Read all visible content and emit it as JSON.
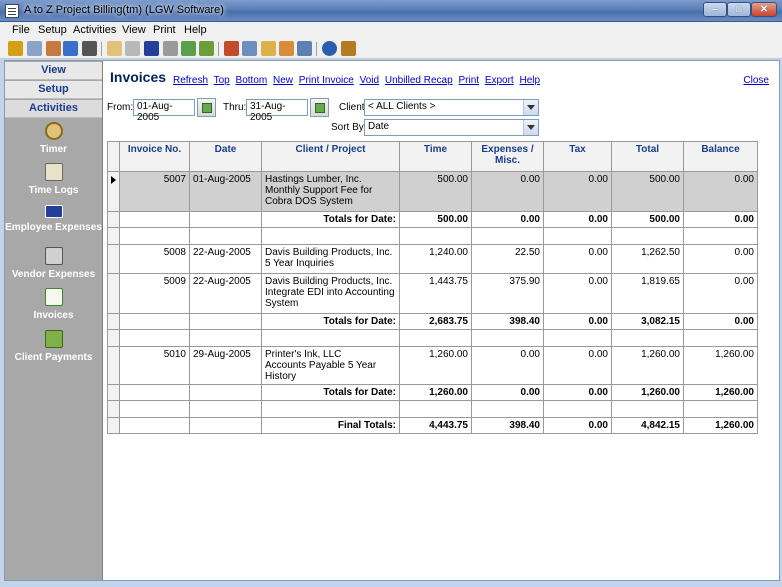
{
  "window": {
    "title": "A to Z Project Billing(tm)  (LGW Software)",
    "min_label": "–",
    "max_label": "□",
    "close_label": "✕"
  },
  "menu": [
    "File",
    "Setup",
    "Activities",
    "View",
    "Print",
    "Help"
  ],
  "toolbar_icons": [
    "users-icon",
    "window-icon",
    "user-icon",
    "people-icon",
    "move-icon",
    "timer-icon",
    "clock-icon",
    "card-icon",
    "calculator-icon",
    "document-icon",
    "ledger-icon",
    "home-icon",
    "grid-icon",
    "report-icon",
    "report2-icon",
    "monitor-icon",
    "help-icon",
    "exit-icon"
  ],
  "sidebar": {
    "view": "View",
    "setup": "Setup",
    "activities": "Activities",
    "nav": [
      "Timer",
      "Time Logs",
      "Employee Expenses",
      "Vendor Expenses",
      "Invoices",
      "Client Payments"
    ]
  },
  "page": {
    "title": "Invoices",
    "links": [
      "Refresh",
      "Top",
      "Bottom",
      "New",
      "Print Invoice",
      "Void",
      "Unbilled Recap",
      "Print",
      "Export",
      "Help"
    ],
    "close": "Close"
  },
  "filters": {
    "from_label": "From:",
    "from_value": "01-Aug-2005",
    "thru_label": "Thru:",
    "thru_value": "31-Aug-2005",
    "client_label": "Client:",
    "client_value": "< ALL Clients >",
    "sort_label": "Sort By:",
    "sort_value": "Date"
  },
  "table": {
    "headers": [
      "Invoice No.",
      "Date",
      "Client / Project",
      "Time",
      "Expenses / Misc.",
      "Tax",
      "Total",
      "Balance"
    ],
    "rows": [
      {
        "invoice": "5007",
        "date": "01-Aug-2005",
        "client": "Hastings Lumber, Inc.",
        "project": "Monthly Support Fee for Cobra DOS System",
        "time": "500.00",
        "expenses": "0.00",
        "tax": "0.00",
        "total": "500.00",
        "balance": "0.00"
      },
      {
        "subtotal_label": "Totals for Date:",
        "time": "500.00",
        "expenses": "0.00",
        "tax": "0.00",
        "total": "500.00",
        "balance": "0.00"
      },
      {
        "invoice": "5008",
        "date": "22-Aug-2005",
        "client": "Davis Building Products, Inc.",
        "project": "5 Year Inquiries",
        "time": "1,240.00",
        "expenses": "22.50",
        "tax": "0.00",
        "total": "1,262.50",
        "balance": "0.00"
      },
      {
        "invoice": "5009",
        "date": "22-Aug-2005",
        "client": "Davis Building Products, Inc.",
        "project": "Integrate EDI into Accounting System",
        "time": "1,443.75",
        "expenses": "375.90",
        "tax": "0.00",
        "total": "1,819.65",
        "balance": "0.00"
      },
      {
        "subtotal_label": "Totals for Date:",
        "time": "2,683.75",
        "expenses": "398.40",
        "tax": "0.00",
        "total": "3,082.15",
        "balance": "0.00"
      },
      {
        "invoice": "5010",
        "date": "29-Aug-2005",
        "client": "Printer's Ink, LLC",
        "project": "Accounts Payable 5 Year History",
        "time": "1,260.00",
        "expenses": "0.00",
        "tax": "0.00",
        "total": "1,260.00",
        "balance": "1,260.00"
      },
      {
        "subtotal_label": "Totals for Date:",
        "time": "1,260.00",
        "expenses": "0.00",
        "tax": "0.00",
        "total": "1,260.00",
        "balance": "1,260.00"
      },
      {
        "subtotal_label": "Final Totals:",
        "time": "4,443.75",
        "expenses": "398.40",
        "tax": "0.00",
        "total": "4,842.15",
        "balance": "1,260.00"
      }
    ]
  }
}
